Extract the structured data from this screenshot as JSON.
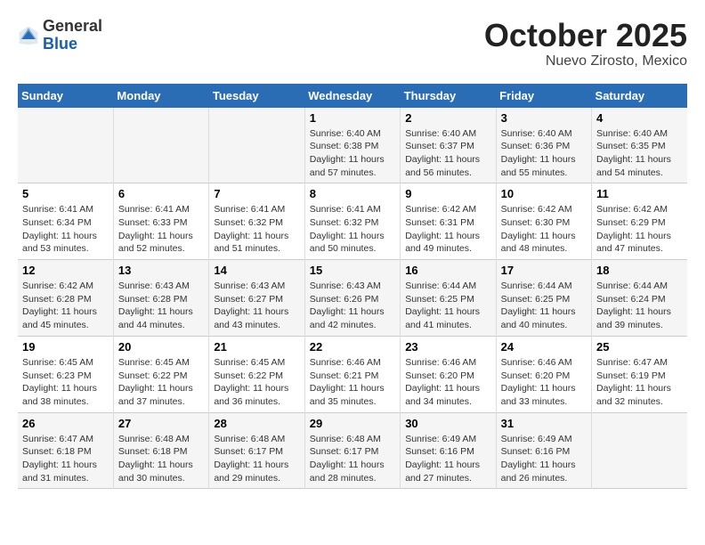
{
  "header": {
    "logo_general": "General",
    "logo_blue": "Blue",
    "month_year": "October 2025",
    "location": "Nuevo Zirosto, Mexico"
  },
  "weekdays": [
    "Sunday",
    "Monday",
    "Tuesday",
    "Wednesday",
    "Thursday",
    "Friday",
    "Saturday"
  ],
  "weeks": [
    [
      {
        "day": "",
        "info": ""
      },
      {
        "day": "",
        "info": ""
      },
      {
        "day": "",
        "info": ""
      },
      {
        "day": "1",
        "info": "Sunrise: 6:40 AM\nSunset: 6:38 PM\nDaylight: 11 hours and 57 minutes."
      },
      {
        "day": "2",
        "info": "Sunrise: 6:40 AM\nSunset: 6:37 PM\nDaylight: 11 hours and 56 minutes."
      },
      {
        "day": "3",
        "info": "Sunrise: 6:40 AM\nSunset: 6:36 PM\nDaylight: 11 hours and 55 minutes."
      },
      {
        "day": "4",
        "info": "Sunrise: 6:40 AM\nSunset: 6:35 PM\nDaylight: 11 hours and 54 minutes."
      }
    ],
    [
      {
        "day": "5",
        "info": "Sunrise: 6:41 AM\nSunset: 6:34 PM\nDaylight: 11 hours and 53 minutes."
      },
      {
        "day": "6",
        "info": "Sunrise: 6:41 AM\nSunset: 6:33 PM\nDaylight: 11 hours and 52 minutes."
      },
      {
        "day": "7",
        "info": "Sunrise: 6:41 AM\nSunset: 6:32 PM\nDaylight: 11 hours and 51 minutes."
      },
      {
        "day": "8",
        "info": "Sunrise: 6:41 AM\nSunset: 6:32 PM\nDaylight: 11 hours and 50 minutes."
      },
      {
        "day": "9",
        "info": "Sunrise: 6:42 AM\nSunset: 6:31 PM\nDaylight: 11 hours and 49 minutes."
      },
      {
        "day": "10",
        "info": "Sunrise: 6:42 AM\nSunset: 6:30 PM\nDaylight: 11 hours and 48 minutes."
      },
      {
        "day": "11",
        "info": "Sunrise: 6:42 AM\nSunset: 6:29 PM\nDaylight: 11 hours and 47 minutes."
      }
    ],
    [
      {
        "day": "12",
        "info": "Sunrise: 6:42 AM\nSunset: 6:28 PM\nDaylight: 11 hours and 45 minutes."
      },
      {
        "day": "13",
        "info": "Sunrise: 6:43 AM\nSunset: 6:28 PM\nDaylight: 11 hours and 44 minutes."
      },
      {
        "day": "14",
        "info": "Sunrise: 6:43 AM\nSunset: 6:27 PM\nDaylight: 11 hours and 43 minutes."
      },
      {
        "day": "15",
        "info": "Sunrise: 6:43 AM\nSunset: 6:26 PM\nDaylight: 11 hours and 42 minutes."
      },
      {
        "day": "16",
        "info": "Sunrise: 6:44 AM\nSunset: 6:25 PM\nDaylight: 11 hours and 41 minutes."
      },
      {
        "day": "17",
        "info": "Sunrise: 6:44 AM\nSunset: 6:25 PM\nDaylight: 11 hours and 40 minutes."
      },
      {
        "day": "18",
        "info": "Sunrise: 6:44 AM\nSunset: 6:24 PM\nDaylight: 11 hours and 39 minutes."
      }
    ],
    [
      {
        "day": "19",
        "info": "Sunrise: 6:45 AM\nSunset: 6:23 PM\nDaylight: 11 hours and 38 minutes."
      },
      {
        "day": "20",
        "info": "Sunrise: 6:45 AM\nSunset: 6:22 PM\nDaylight: 11 hours and 37 minutes."
      },
      {
        "day": "21",
        "info": "Sunrise: 6:45 AM\nSunset: 6:22 PM\nDaylight: 11 hours and 36 minutes."
      },
      {
        "day": "22",
        "info": "Sunrise: 6:46 AM\nSunset: 6:21 PM\nDaylight: 11 hours and 35 minutes."
      },
      {
        "day": "23",
        "info": "Sunrise: 6:46 AM\nSunset: 6:20 PM\nDaylight: 11 hours and 34 minutes."
      },
      {
        "day": "24",
        "info": "Sunrise: 6:46 AM\nSunset: 6:20 PM\nDaylight: 11 hours and 33 minutes."
      },
      {
        "day": "25",
        "info": "Sunrise: 6:47 AM\nSunset: 6:19 PM\nDaylight: 11 hours and 32 minutes."
      }
    ],
    [
      {
        "day": "26",
        "info": "Sunrise: 6:47 AM\nSunset: 6:18 PM\nDaylight: 11 hours and 31 minutes."
      },
      {
        "day": "27",
        "info": "Sunrise: 6:48 AM\nSunset: 6:18 PM\nDaylight: 11 hours and 30 minutes."
      },
      {
        "day": "28",
        "info": "Sunrise: 6:48 AM\nSunset: 6:17 PM\nDaylight: 11 hours and 29 minutes."
      },
      {
        "day": "29",
        "info": "Sunrise: 6:48 AM\nSunset: 6:17 PM\nDaylight: 11 hours and 28 minutes."
      },
      {
        "day": "30",
        "info": "Sunrise: 6:49 AM\nSunset: 6:16 PM\nDaylight: 11 hours and 27 minutes."
      },
      {
        "day": "31",
        "info": "Sunrise: 6:49 AM\nSunset: 6:16 PM\nDaylight: 11 hours and 26 minutes."
      },
      {
        "day": "",
        "info": ""
      }
    ]
  ]
}
